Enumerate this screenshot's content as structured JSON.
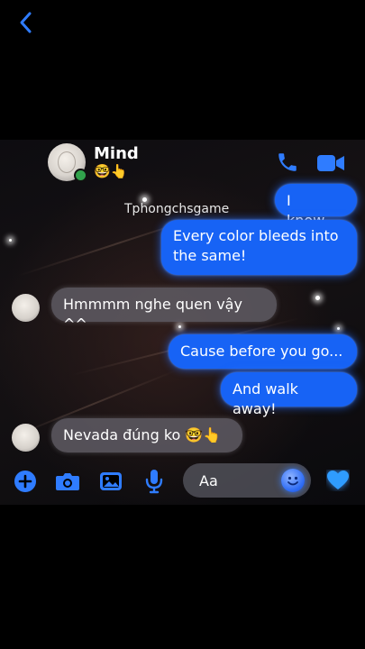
{
  "header": {
    "contact_name": "Mind",
    "contact_status": "🤓👆",
    "watermark": "Tphongchsgame"
  },
  "messages": [
    {
      "side": "outgoing",
      "text": "I know..."
    },
    {
      "side": "outgoing",
      "text": "Every color bleeds into the same!"
    },
    {
      "side": "incoming",
      "text": "Hmmmm nghe quen vậy ^^"
    },
    {
      "side": "outgoing",
      "text": "Cause before you go..."
    },
    {
      "side": "outgoing",
      "text": "And walk away!"
    },
    {
      "side": "incoming",
      "text": "Nevada đúng ko 🤓👆"
    }
  ],
  "composer": {
    "placeholder": "Aa",
    "icons": [
      "plus-icon",
      "camera-icon",
      "image-icon",
      "microphone-icon",
      "emoji-icon",
      "heart-icon"
    ]
  },
  "colors": {
    "accent": "#1763f5",
    "incoming_bubble": "#5f5c64",
    "online": "#31a24c"
  }
}
